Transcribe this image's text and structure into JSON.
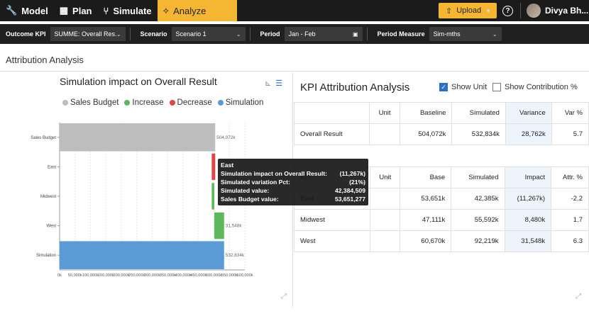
{
  "nav": {
    "items": [
      {
        "label": "Model",
        "icon": "wrench-icon"
      },
      {
        "label": "Plan",
        "icon": "table-icon"
      },
      {
        "label": "Simulate",
        "icon": "branch-icon"
      },
      {
        "label": "Analyze",
        "icon": "analyze-icon"
      }
    ],
    "upload_label": "Upload",
    "help": "?",
    "user_name": "Divya Bh..."
  },
  "filters": {
    "outcome_kpi_label": "Outcome KPI",
    "outcome_kpi_value": "SUMME: Overall Res...",
    "scenario_label": "Scenario",
    "scenario_value": "Scenario 1",
    "period_label": "Period",
    "period_value": "Jan - Feb",
    "period_measure_label": "Period Measure",
    "period_measure_value": "Sim-mths"
  },
  "section_title": "Attribution Analysis",
  "chart_data": {
    "type": "bar",
    "orientation": "horizontal",
    "title": "Simulation impact on Overall Result",
    "legend": [
      {
        "name": "Sales Budget",
        "color": "#bdbdbd"
      },
      {
        "name": "Increase",
        "color": "#5cb85c"
      },
      {
        "name": "Decrease",
        "color": "#e04444"
      },
      {
        "name": "Simulation",
        "color": "#5b9bd5"
      }
    ],
    "categories": [
      "Sales Budget",
      "East",
      "Midwest",
      "West",
      "Simulation"
    ],
    "bars": [
      {
        "category": "Sales Budget",
        "start": 0,
        "end": 504072,
        "kind": "Sales Budget",
        "label": "504,072k"
      },
      {
        "category": "East",
        "start": 492805,
        "end": 504072,
        "kind": "Decrease",
        "label": ""
      },
      {
        "category": "Midwest",
        "start": 492805,
        "end": 501286,
        "kind": "Increase",
        "label": ""
      },
      {
        "category": "West",
        "start": 501286,
        "end": 532834,
        "kind": "Increase",
        "label": "31,548k"
      },
      {
        "category": "Simulation",
        "start": 0,
        "end": 532834,
        "kind": "Simulation",
        "label": "532,834k"
      }
    ],
    "xticks": [
      "0k",
      "50,000k",
      "100,000k",
      "150,000k",
      "200,000k",
      "250,000k",
      "300,000k",
      "350,000k",
      "400,000k",
      "450,000k",
      "500,000k",
      "550,000k",
      "600,000k"
    ],
    "xlim": [
      0,
      600000
    ]
  },
  "tooltip": {
    "title": "East",
    "rows": [
      {
        "label": "Simulation impact on Overall Result:",
        "value": "(11,267k)"
      },
      {
        "label": "Simulated variation Pct:",
        "value": "(21%)"
      },
      {
        "label": "Simulated value:",
        "value": "42,384,509"
      },
      {
        "label": "Sales Budget value:",
        "value": "53,651,277"
      }
    ]
  },
  "kpi": {
    "title": "KPI Attribution Analysis",
    "show_unit_label": "Show Unit",
    "show_contribution_label": "Show Contribution %",
    "table1": {
      "headers": [
        "",
        "Unit",
        "Baseline",
        "Simulated",
        "Variance",
        "Var %"
      ],
      "rows": [
        [
          "Overall Result",
          "",
          "504,072k",
          "532,834k",
          "28,762k",
          "5.7"
        ]
      ]
    },
    "table2": {
      "headers": [
        "KPI",
        "Unit",
        "Base",
        "Simulated",
        "Impact",
        "Attr. %"
      ],
      "rows": [
        [
          "East",
          "",
          "53,651k",
          "42,385k",
          "(11,267k)",
          "-2.2"
        ],
        [
          "Midwest",
          "",
          "47,111k",
          "55,592k",
          "8,480k",
          "1.7"
        ],
        [
          "West",
          "",
          "60,670k",
          "92,219k",
          "31,548k",
          "6.3"
        ]
      ]
    }
  }
}
